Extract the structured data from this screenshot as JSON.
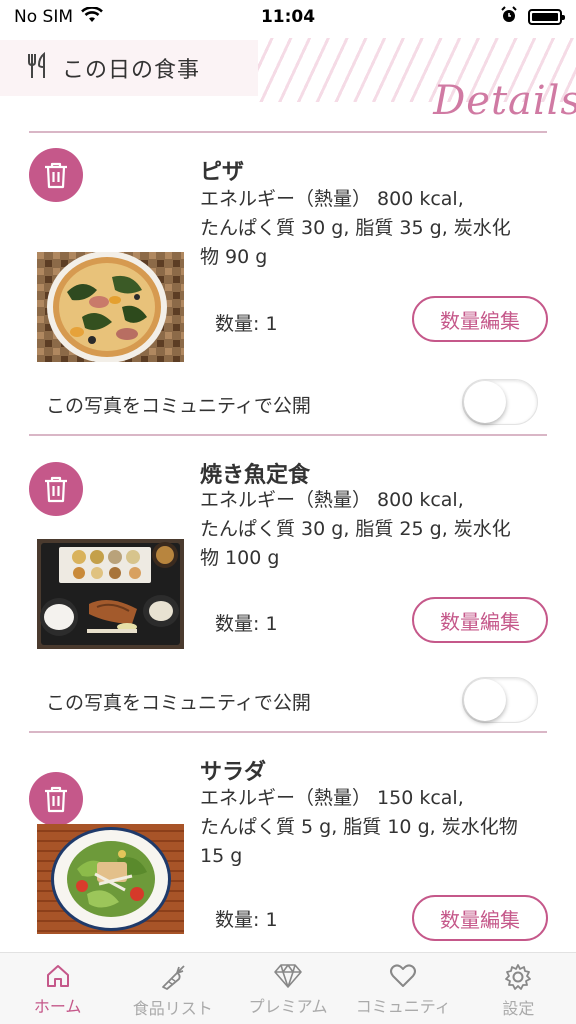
{
  "status_bar": {
    "carrier": "No SIM",
    "time": "11:04"
  },
  "header": {
    "title": "この日の食事",
    "details_word": "Details"
  },
  "colors": {
    "accent": "#c5588a",
    "divider": "#d9b6c6",
    "tab_active": "#c5588a",
    "tab_inactive": "#aaaaaa"
  },
  "foods": [
    {
      "name": "ピザ",
      "desc_line1": "エネルギー（熱量） 800 kcal,",
      "desc_line2": "たんぱく質 30 g, 脂質 35 g, 炭水化",
      "desc_line3": "物 90 g",
      "quantity": "数量: 1",
      "edit_label": "数量編集",
      "share_label": "この写真をコミュニティで公開",
      "share_enabled": false,
      "photo": "pizza-photo"
    },
    {
      "name": "焼き魚定食",
      "desc_line1": "エネルギー（熱量） 800 kcal,",
      "desc_line2": "たんぱく質 30 g, 脂質 25 g, 炭水化",
      "desc_line3": "物 100 g",
      "quantity": "数量: 1",
      "edit_label": "数量編集",
      "share_label": "この写真をコミュニティで公開",
      "share_enabled": false,
      "photo": "grilled-fish-set-photo"
    },
    {
      "name": "サラダ",
      "desc_line1": "エネルギー（熱量） 150 kcal,",
      "desc_line2": "たんぱく質 5 g, 脂質 10 g, 炭水化物",
      "desc_line3": "15 g",
      "quantity": "数量: 1",
      "edit_label": "数量編集",
      "photo": "salad-photo"
    }
  ],
  "tab_bar": {
    "active": 0,
    "items": [
      {
        "label": "ホーム",
        "icon": "home-icon"
      },
      {
        "label": "食品リスト",
        "icon": "carrot-icon"
      },
      {
        "label": "プレミアム",
        "icon": "diamond-icon"
      },
      {
        "label": "コミュニティ",
        "icon": "heart-icon"
      },
      {
        "label": "設定",
        "icon": "gear-icon"
      }
    ]
  }
}
